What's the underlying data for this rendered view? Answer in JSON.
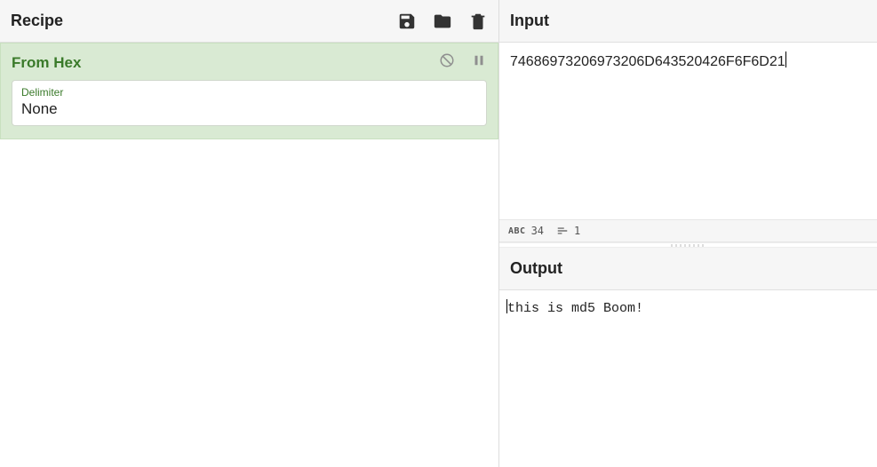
{
  "recipe": {
    "title": "Recipe",
    "operations": [
      {
        "name": "From Hex",
        "fields": [
          {
            "label": "Delimiter",
            "value": "None"
          }
        ]
      }
    ]
  },
  "input": {
    "title": "Input",
    "value": "74686973206973206D643520426F6F6D21",
    "char_count": "34",
    "line_count": "1"
  },
  "output": {
    "title": "Output",
    "value": "this is md5 Boom!"
  }
}
